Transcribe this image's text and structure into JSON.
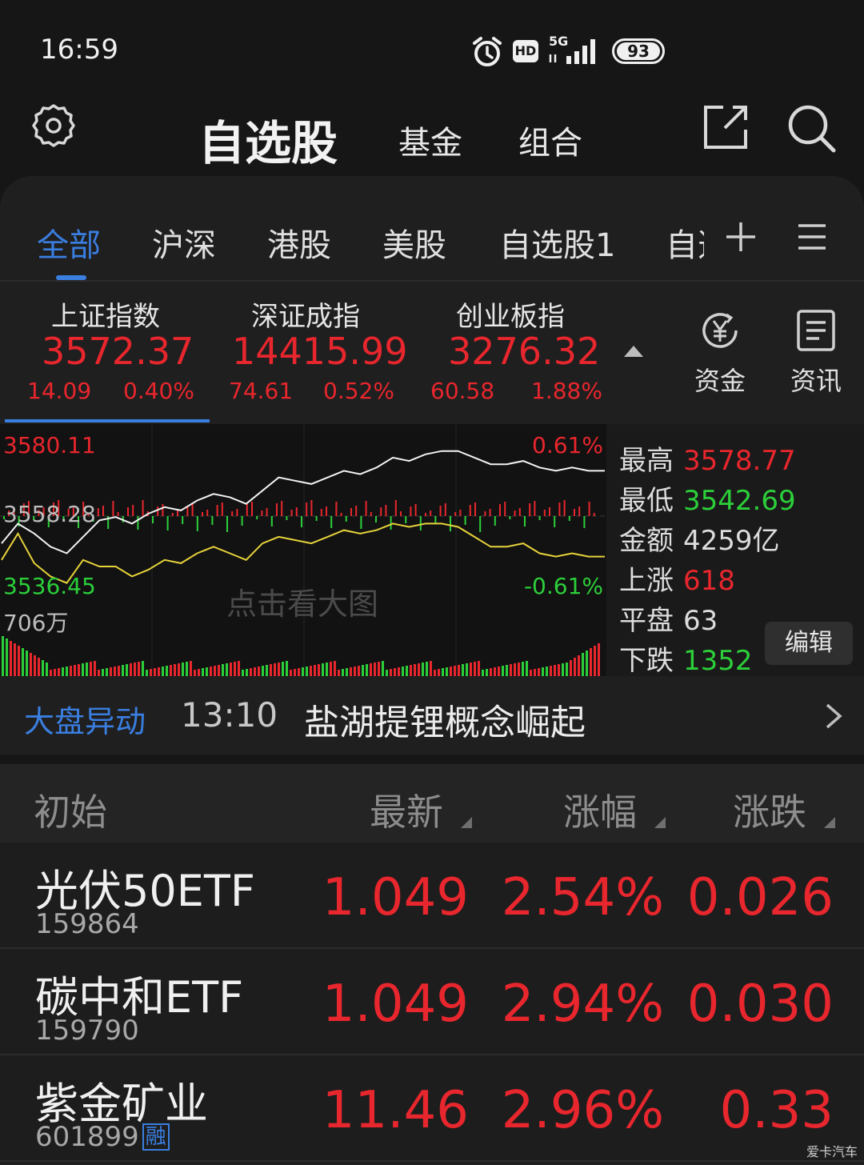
{
  "status": {
    "time": "16:59",
    "network": "5G",
    "hd": "HD",
    "battery": "93"
  },
  "header": {
    "title": "自选股",
    "tabs": [
      "基金",
      "组合"
    ],
    "icons": [
      "settings-icon",
      "share-icon",
      "search-icon"
    ]
  },
  "categories": {
    "items": [
      "全部",
      "沪深",
      "港股",
      "美股",
      "自选股1"
    ],
    "overflow": "自选",
    "active_index": 0
  },
  "indices": [
    {
      "name": "上证指数",
      "value": "3572.37",
      "change": "14.09",
      "pct": "0.40%"
    },
    {
      "name": "深证成指",
      "value": "14415.99",
      "change": "74.61",
      "pct": "0.52%"
    },
    {
      "name": "创业板指",
      "value": "3276.32",
      "change": "60.58",
      "pct": "1.88%"
    }
  ],
  "side_buttons": [
    {
      "label": "资金",
      "icon": "yuan-flow-icon"
    },
    {
      "label": "资讯",
      "icon": "news-icon"
    }
  ],
  "chart": {
    "high_label": "3580.11",
    "mid_label": "3558.28",
    "low_label": "3536.45",
    "top_pct": "0.61%",
    "bottom_pct": "-0.61%",
    "volume_label": "706万",
    "overlay_hint": "点击看大图"
  },
  "chart_data": {
    "type": "line",
    "title": "",
    "ylim": [
      3536.45,
      3580.11
    ],
    "series": [
      {
        "values": [
          3550,
          3556,
          3553,
          3549,
          3547,
          3552,
          3557,
          3558,
          3556,
          3559,
          3561,
          3560,
          3563,
          3565,
          3564,
          3562,
          3566,
          3570,
          3569,
          3568,
          3570,
          3572,
          3571,
          3573,
          3576,
          3575,
          3577,
          3578,
          3578,
          3576,
          3574,
          3574,
          3575,
          3573,
          3572,
          3573,
          3572,
          3572
        ]
      },
      {
        "values": [
          3545,
          3553,
          3544,
          3540,
          3538,
          3545,
          3543,
          3543,
          3540,
          3542,
          3545,
          3544,
          3547,
          3549,
          3547,
          3545,
          3550,
          3552,
          3551,
          3550,
          3552,
          3554,
          3553,
          3554,
          3556,
          3555,
          3556,
          3556,
          3555,
          3552,
          3549,
          3549,
          3550,
          3547,
          3546,
          3547,
          3546,
          3546
        ]
      }
    ],
    "volume_max": 706
  },
  "stats": {
    "high": {
      "label": "最高",
      "value": "3578.77"
    },
    "low": {
      "label": "最低",
      "value": "3542.69"
    },
    "amount": {
      "label": "金额",
      "value": "4259亿"
    },
    "up": {
      "label": "上涨",
      "value": "618"
    },
    "flat": {
      "label": "平盘",
      "value": "63"
    },
    "down": {
      "label": "下跌",
      "value": "1352"
    },
    "edit": "编辑"
  },
  "alert": {
    "tag": "大盘异动",
    "time": "13:10",
    "text": "盐湖提锂概念崛起"
  },
  "list_header": {
    "col0": "初始",
    "col1": "最新",
    "col2": "涨幅",
    "col3": "涨跌"
  },
  "rows": [
    {
      "name": "光伏50ETF",
      "code": "159864",
      "badge": "",
      "price": "1.049",
      "pct": "2.54%",
      "change": "0.026"
    },
    {
      "name": "碳中和ETF",
      "code": "159790",
      "badge": "",
      "price": "1.049",
      "pct": "2.94%",
      "change": "0.030"
    },
    {
      "name": "紫金矿业",
      "code": "601899",
      "badge": "融",
      "price": "11.46",
      "pct": "2.96%",
      "change": "0.33"
    }
  ],
  "watermark": "爱卡汽车",
  "colors": {
    "up": "#e8262d",
    "down": "#2ccf3a",
    "accent": "#3a7ee0"
  }
}
